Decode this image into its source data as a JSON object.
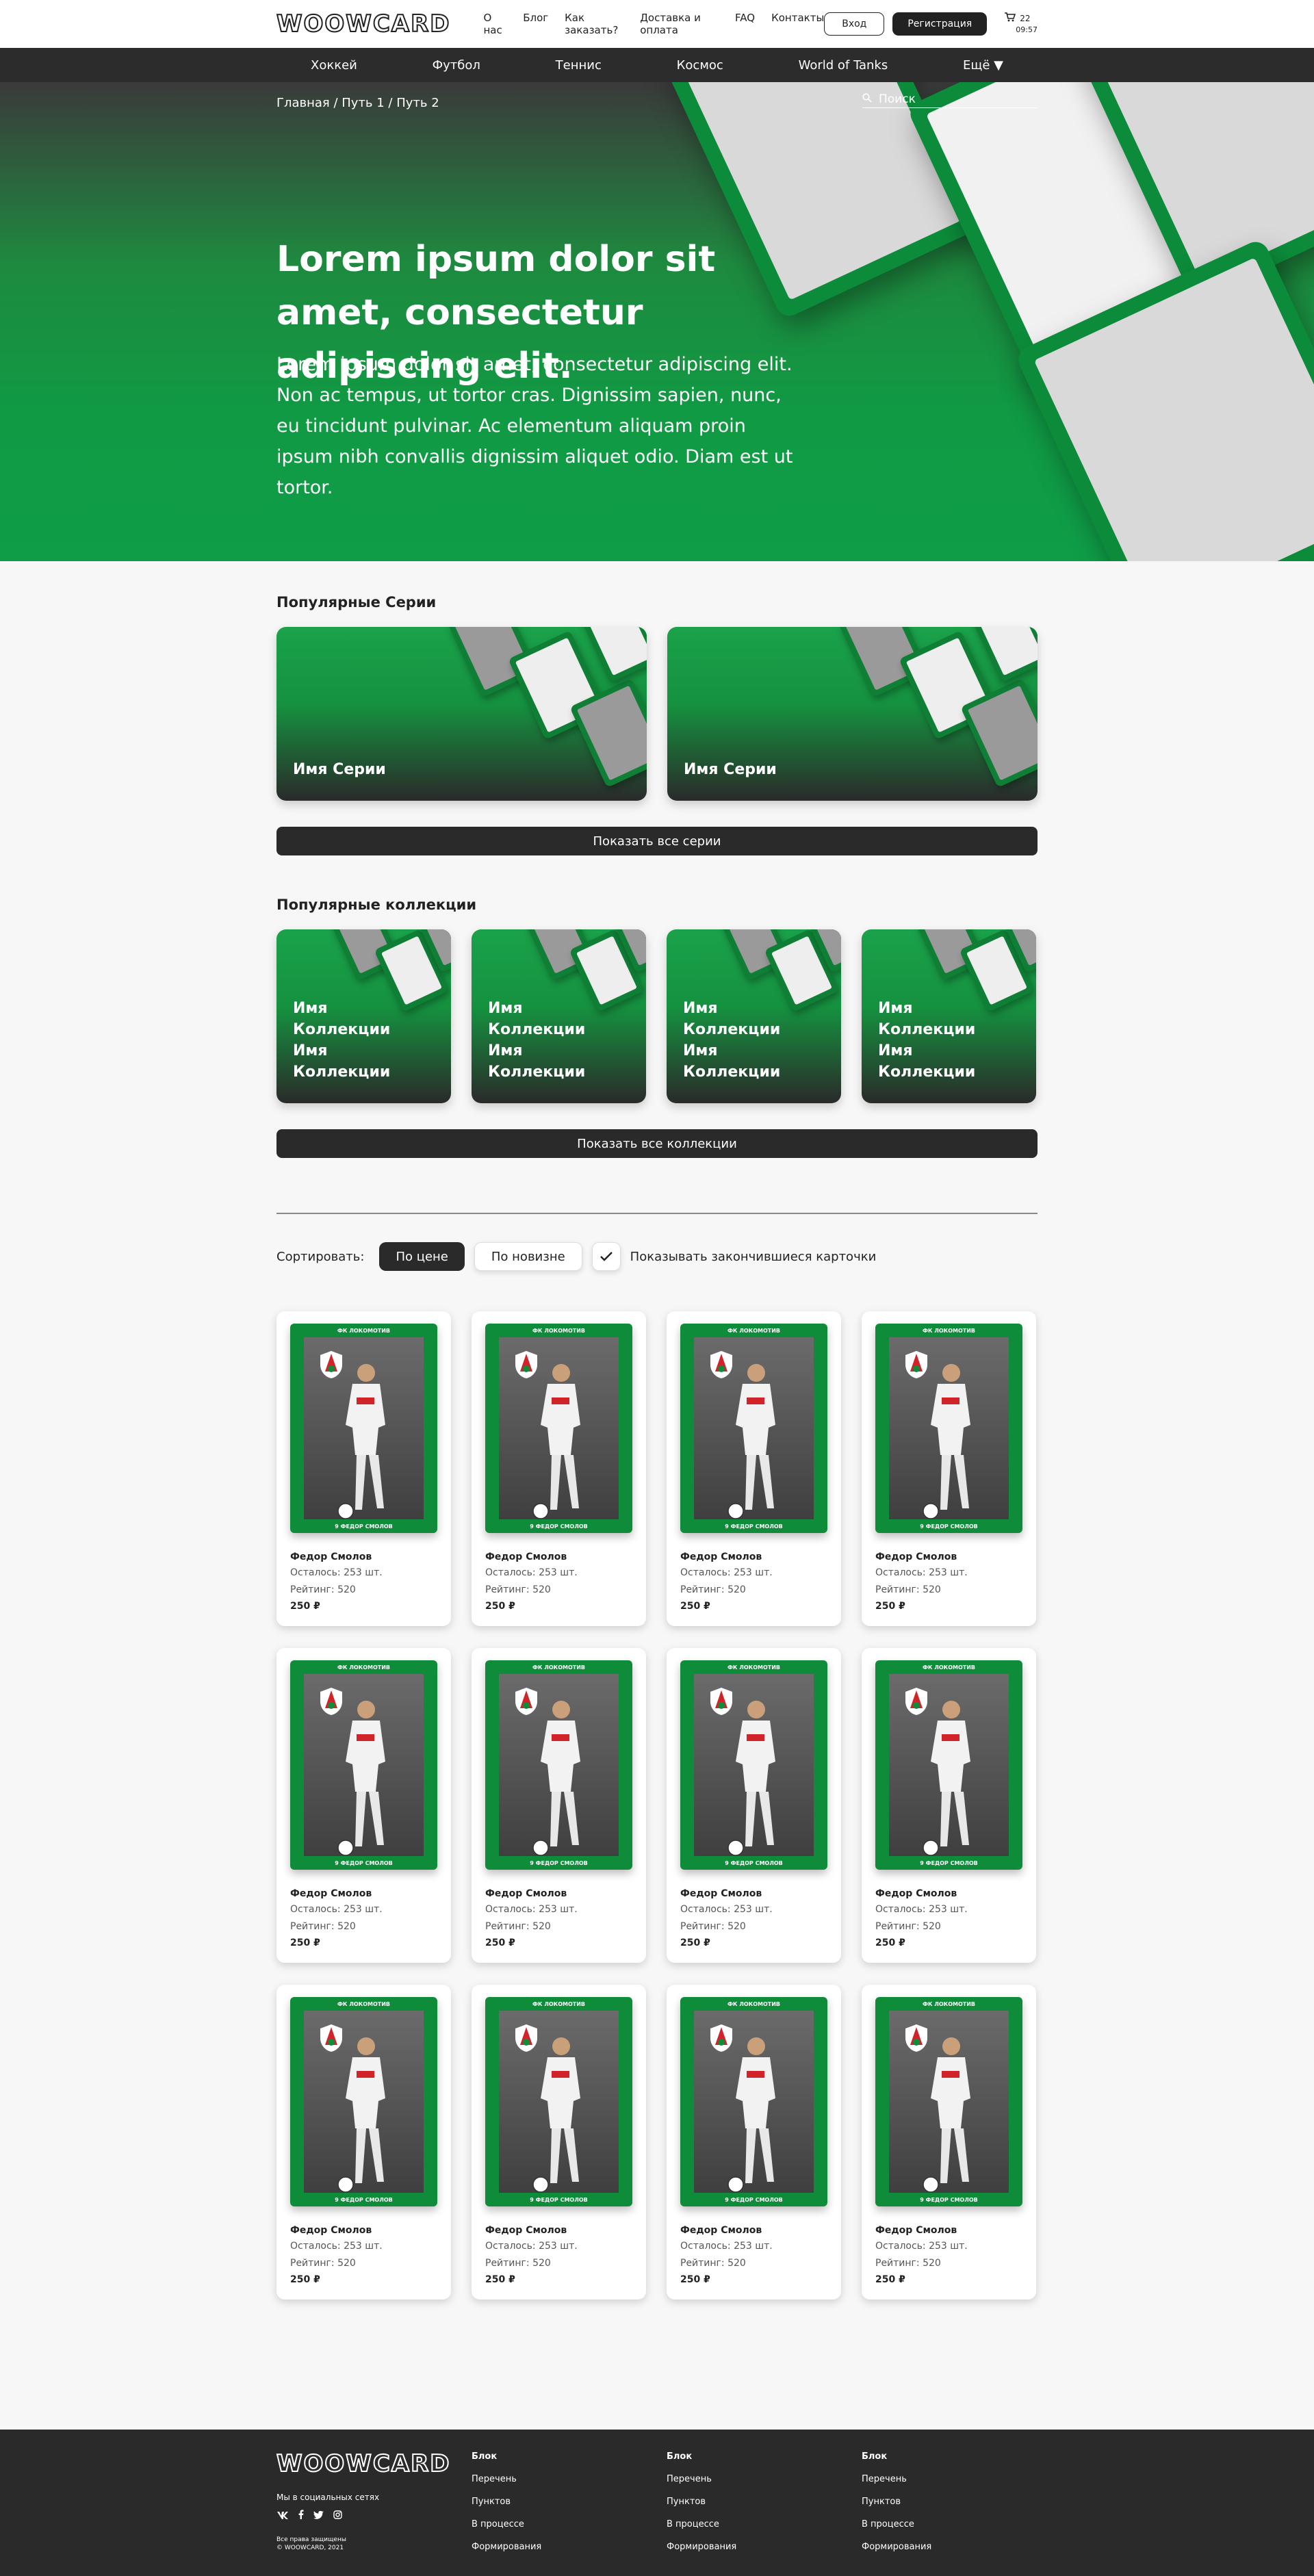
{
  "header": {
    "logo": "WOOWCARD",
    "nav": [
      "О нас",
      "Блог",
      "Как заказать?",
      "Доставка и оплата",
      "FAQ",
      "Контакты"
    ],
    "login": "Вход",
    "register": "Регистрация",
    "cart_count": "22",
    "cart_time": "09:57"
  },
  "categories": [
    "Хоккей",
    "Футбол",
    "Теннис",
    "Космос",
    "World of Tanks",
    "Ещё ▼"
  ],
  "hero": {
    "breadcrumb": "Главная / Путь 1 / Путь 2",
    "search_placeholder": "Поиск",
    "title": "Lorem ipsum dolor sit amet, consectetur adipiscing elit.",
    "text": "Lorem ipsum dolor sit amet, consectetur adipiscing elit. Non ac tempus, ut tortor cras. Dignissim sapien, nunc, eu tincidunt pulvinar. Ac elementum aliquam proin ipsum nibh convallis dignissim aliquet odio. Diam est ut tortor."
  },
  "series": {
    "title": "Популярные Серии",
    "items": [
      "Имя Серии",
      "Имя Серии"
    ],
    "show_all": "Показать все серии"
  },
  "collections": {
    "title": "Популярные коллекции",
    "items": [
      "Имя Коллекции Имя Коллекции",
      "Имя Коллекции Имя Коллекции",
      "Имя Коллекции Имя Коллекции",
      "Имя Коллекции Имя Коллекции"
    ],
    "show_all": "Показать все коллекции"
  },
  "sort": {
    "label": "Сортировать:",
    "by_price": "По цене",
    "by_new": "По новизне",
    "show_ended": "Показывать закончившиеся карточки",
    "show_ended_checked": true
  },
  "card_print": {
    "club": "ФК ЛОКОМОТИВ",
    "player": "9 ФЕДОР СМОЛОВ"
  },
  "products": [
    {
      "name": "Федор Смолов",
      "left": "Осталось: 253 шт.",
      "rating": "Рейтинг: 520",
      "price": "250 ₽"
    },
    {
      "name": "Федор Смолов",
      "left": "Осталось: 253 шт.",
      "rating": "Рейтинг: 520",
      "price": "250 ₽"
    },
    {
      "name": "Федор Смолов",
      "left": "Осталось: 253 шт.",
      "rating": "Рейтинг: 520",
      "price": "250 ₽"
    },
    {
      "name": "Федор Смолов",
      "left": "Осталось: 253 шт.",
      "rating": "Рейтинг: 520",
      "price": "250 ₽"
    },
    {
      "name": "Федор Смолов",
      "left": "Осталось: 253 шт.",
      "rating": "Рейтинг: 520",
      "price": "250 ₽"
    },
    {
      "name": "Федор Смолов",
      "left": "Осталось: 253 шт.",
      "rating": "Рейтинг: 520",
      "price": "250 ₽"
    },
    {
      "name": "Федор Смолов",
      "left": "Осталось: 253 шт.",
      "rating": "Рейтинг: 520",
      "price": "250 ₽"
    },
    {
      "name": "Федор Смолов",
      "left": "Осталось: 253 шт.",
      "rating": "Рейтинг: 520",
      "price": "250 ₽"
    },
    {
      "name": "Федор Смолов",
      "left": "Осталось: 253 шт.",
      "rating": "Рейтинг: 520",
      "price": "250 ₽"
    },
    {
      "name": "Федор Смолов",
      "left": "Осталось: 253 шт.",
      "rating": "Рейтинг: 520",
      "price": "250 ₽"
    },
    {
      "name": "Федор Смолов",
      "left": "Осталось: 253 шт.",
      "rating": "Рейтинг: 520",
      "price": "250 ₽"
    },
    {
      "name": "Федор Смолов",
      "left": "Осталось: 253 шт.",
      "rating": "Рейтинг: 520",
      "price": "250 ₽"
    }
  ],
  "footer": {
    "logo": "WOOWCARD",
    "social_label": "Мы в социальных сетях",
    "socials": [
      "vk-icon",
      "facebook-icon",
      "twitter-icon",
      "instagram-icon"
    ],
    "copyright": "Все права защищены\n© WOOWCARD, 2021",
    "columns": [
      {
        "title": "Блок",
        "links": [
          "Перечень",
          "Пунктов",
          "В процессе",
          "Формирования"
        ]
      },
      {
        "title": "Блок",
        "links": [
          "Перечень",
          "Пунктов",
          "В процессе",
          "Формирования"
        ]
      },
      {
        "title": "Блок",
        "links": [
          "Перечень",
          "Пунктов",
          "В процессе",
          "Формирования"
        ]
      }
    ]
  },
  "colors": {
    "brand_green": "#109a44",
    "dark": "#2a2a2a",
    "background": "#f7f7f7"
  }
}
